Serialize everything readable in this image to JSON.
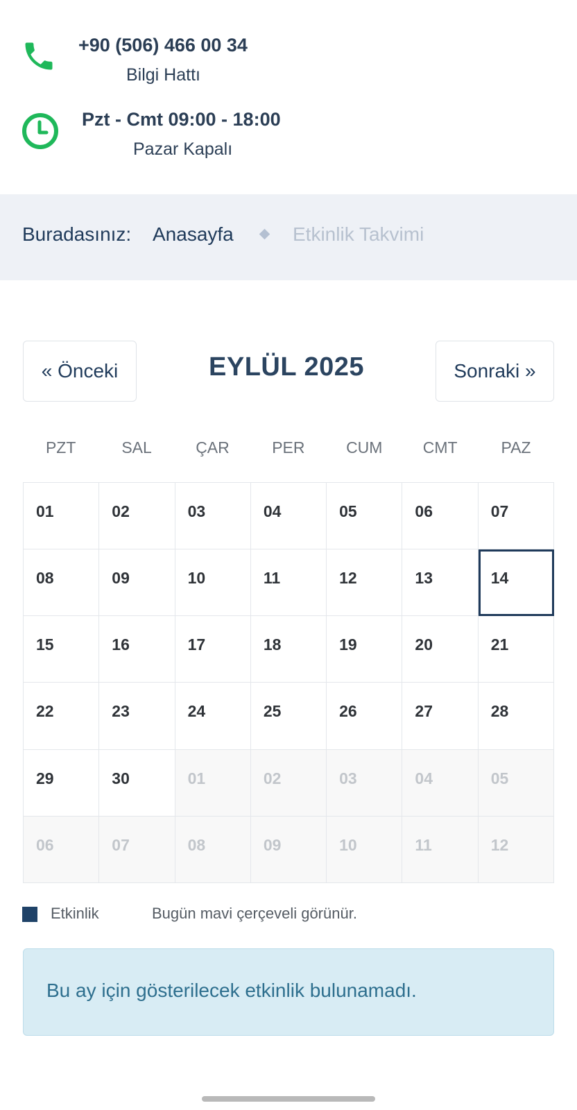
{
  "contact": {
    "phone": "+90 (506) 466 00 34",
    "phone_label": "Bilgi Hattı",
    "hours": "Pzt - Cmt 09:00 - 18:00",
    "hours_label": "Pazar Kapalı",
    "icon_color": "#1fb85a"
  },
  "breadcrumb": {
    "prefix": "Buradasınız:",
    "home": "Anasayfa",
    "current": "Etkinlik Takvimi"
  },
  "calendar": {
    "prev_label": "« Önceki",
    "next_label": "Sonraki »",
    "month_title": "EYLÜL 2025",
    "weekdays": [
      "PZT",
      "SAL",
      "ÇAR",
      "PER",
      "CUM",
      "CMT",
      "PAZ"
    ],
    "weeks": [
      [
        "01",
        "02",
        "03",
        "04",
        "05",
        "06",
        "07"
      ],
      [
        "08",
        "09",
        "10",
        "11",
        "12",
        "13",
        "14"
      ],
      [
        "15",
        "16",
        "17",
        "18",
        "19",
        "20",
        "21"
      ],
      [
        "22",
        "23",
        "24",
        "25",
        "26",
        "27",
        "28"
      ],
      [
        "29",
        "30",
        "01",
        "02",
        "03",
        "04",
        "05"
      ],
      [
        "06",
        "07",
        "08",
        "09",
        "10",
        "11",
        "12"
      ]
    ],
    "today": "14",
    "accent_color": "#1f3a5a"
  },
  "legend": {
    "event_label": "Etkinlik",
    "today_note": "Bugün mavi çerçeveli görünür.",
    "swatch_color": "#1f4268"
  },
  "alert": {
    "message": "Bu ay için gösterilecek etkinlik bulunamadı."
  }
}
